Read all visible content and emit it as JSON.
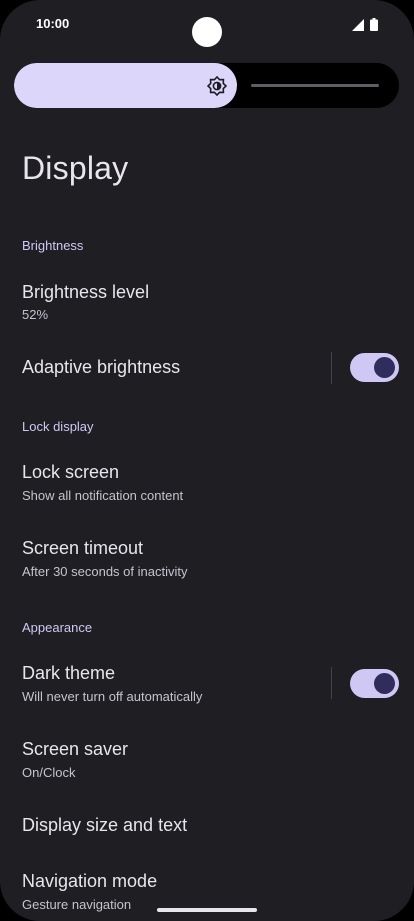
{
  "status_bar": {
    "time": "10:00"
  },
  "brightness_slider": {
    "level_fraction": 0.58
  },
  "page": {
    "title": "Display"
  },
  "sections": {
    "brightness": {
      "header": "Brightness",
      "level": {
        "title": "Brightness level",
        "subtitle": "52%"
      },
      "adaptive": {
        "title": "Adaptive brightness",
        "enabled": true
      }
    },
    "lock_display": {
      "header": "Lock display",
      "lock_screen": {
        "title": "Lock screen",
        "subtitle": "Show all notification content"
      },
      "timeout": {
        "title": "Screen timeout",
        "subtitle": "After 30 seconds of inactivity"
      }
    },
    "appearance": {
      "header": "Appearance",
      "dark_theme": {
        "title": "Dark theme",
        "subtitle": "Will never turn off automatically",
        "enabled": true
      },
      "screen_saver": {
        "title": "Screen saver",
        "subtitle": "On/Clock"
      },
      "display_size": {
        "title": "Display size and text"
      },
      "navigation_mode": {
        "title": "Navigation mode",
        "subtitle": "Gesture navigation"
      }
    }
  },
  "colors": {
    "background": "#1f1e23",
    "accent": "#cfc8f5",
    "slider_fill": "#dcd6fb",
    "switch_thumb": "#302c5c"
  }
}
